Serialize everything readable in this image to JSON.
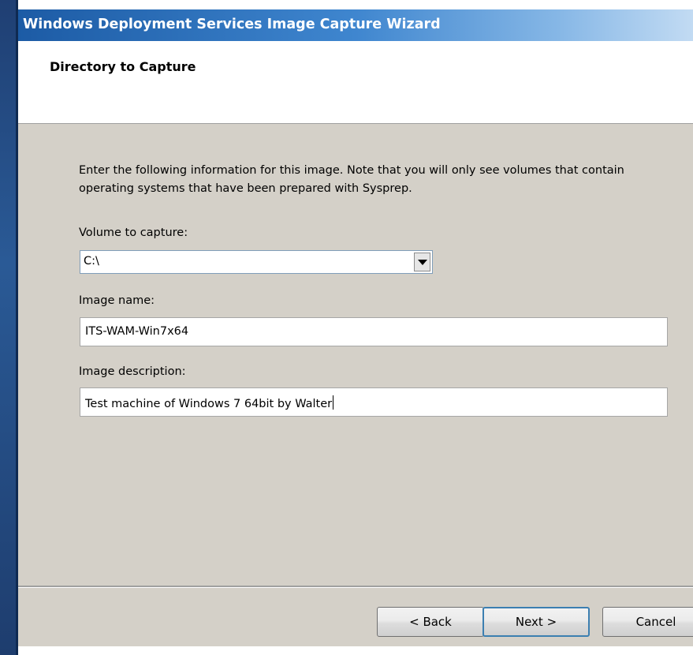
{
  "window": {
    "title": "Windows Deployment Services Image Capture Wizard"
  },
  "header": {
    "title": "Directory to Capture"
  },
  "body": {
    "intro": "Enter the following information for this image. Note that you will only see volumes that contain operating systems that have been prepared with Sysprep.",
    "volume_label": "Volume to capture:",
    "volume_value": "C:\\",
    "image_name_label": "Image name:",
    "image_name_value": "ITS-WAM-Win7x64",
    "image_description_label": "Image description:",
    "image_description_value": "Test machine of Windows 7 64bit by Walter"
  },
  "footer": {
    "back_label": "< Back",
    "next_label": "Next >",
    "cancel_label": "Cancel"
  },
  "colors": {
    "title_bar_start": "#1c5ba5",
    "title_bar_end": "#c2dbf3",
    "dialog_body": "#d4d0c8",
    "default_button_border": "#3c7fb1"
  },
  "icons": {
    "combo_arrow": "chevron-down-icon"
  }
}
